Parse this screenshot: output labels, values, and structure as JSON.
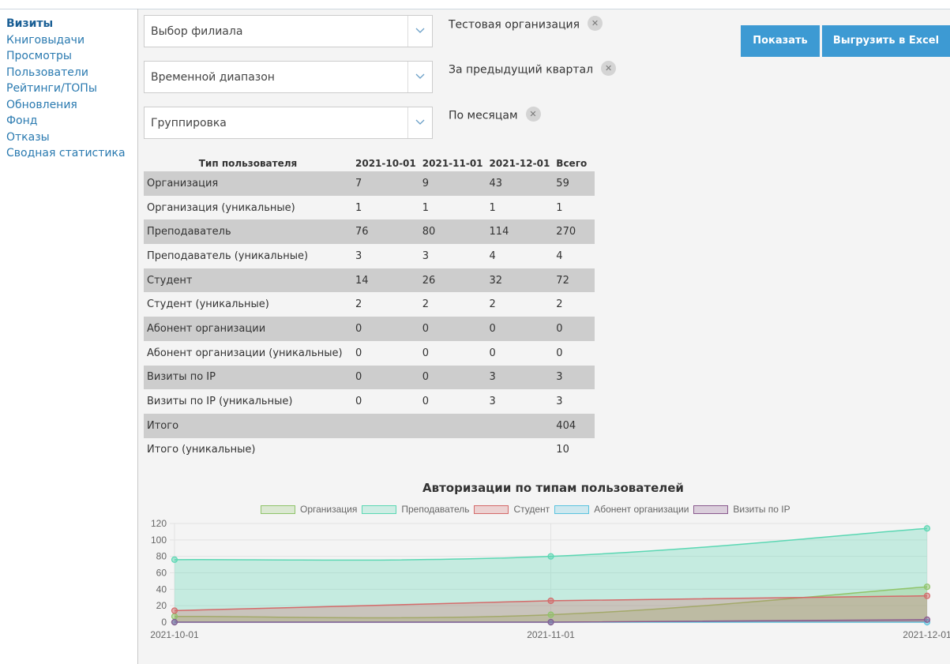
{
  "sidebar": {
    "items": [
      {
        "label": "Визиты",
        "active": true
      },
      {
        "label": "Книговыдачи"
      },
      {
        "label": "Просмотры"
      },
      {
        "label": "Пользователи"
      },
      {
        "label": "Рейтинги/ТОПы"
      },
      {
        "label": "Обновления"
      },
      {
        "label": "Фонд"
      },
      {
        "label": "Отказы"
      },
      {
        "label": "Сводная статистика"
      }
    ]
  },
  "filters": {
    "branch": {
      "placeholder": "Выбор филиала",
      "chip": "Тестовая организация"
    },
    "range": {
      "placeholder": "Временной диапазон",
      "chip": "За предыдущий квартал"
    },
    "grouping": {
      "placeholder": "Группировка",
      "chip": "По месяцам"
    }
  },
  "buttons": {
    "show": "Показать",
    "export": "Выгрузить в Excel"
  },
  "table": {
    "headers": [
      "Тип пользователя",
      "2021-10-01",
      "2021-11-01",
      "2021-12-01",
      "Всего"
    ],
    "rows": [
      [
        "Организация",
        "7",
        "9",
        "43",
        "59"
      ],
      [
        "Организация (уникальные)",
        "1",
        "1",
        "1",
        "1"
      ],
      [
        "Преподаватель",
        "76",
        "80",
        "114",
        "270"
      ],
      [
        "Преподаватель (уникальные)",
        "3",
        "3",
        "4",
        "4"
      ],
      [
        "Студент",
        "14",
        "26",
        "32",
        "72"
      ],
      [
        "Студент (уникальные)",
        "2",
        "2",
        "2",
        "2"
      ],
      [
        "Абонент организации",
        "0",
        "0",
        "0",
        "0"
      ],
      [
        "Абонент организации (уникальные)",
        "0",
        "0",
        "0",
        "0"
      ],
      [
        "Визиты по IP",
        "0",
        "0",
        "3",
        "3"
      ],
      [
        "Визиты по IP (уникальные)",
        "0",
        "0",
        "3",
        "3"
      ],
      [
        "Итого",
        "",
        "",
        "",
        "404"
      ],
      [
        "Итого (уникальные)",
        "",
        "",
        "",
        "10"
      ]
    ]
  },
  "chart_data": {
    "type": "area",
    "title": "Авторизации по типам пользователей",
    "x": [
      "2021-10-01",
      "2021-11-01",
      "2021-12-01"
    ],
    "ylim": [
      0,
      120
    ],
    "yticks": [
      0,
      20,
      40,
      60,
      80,
      100,
      120
    ],
    "grid": true,
    "legend": "top",
    "series": [
      {
        "name": "Организация",
        "values": [
          7,
          9,
          43
        ],
        "color": "#8fc46a"
      },
      {
        "name": "Преподаватель",
        "values": [
          76,
          80,
          114
        ],
        "color": "#5bd7b3"
      },
      {
        "name": "Студент",
        "values": [
          14,
          26,
          32
        ],
        "color": "#d46a6a"
      },
      {
        "name": "Абонент организации",
        "values": [
          0,
          0,
          0
        ],
        "color": "#5bc3de"
      },
      {
        "name": "Визиты по IP",
        "values": [
          0,
          0,
          3
        ],
        "color": "#8a5a8e"
      }
    ]
  }
}
